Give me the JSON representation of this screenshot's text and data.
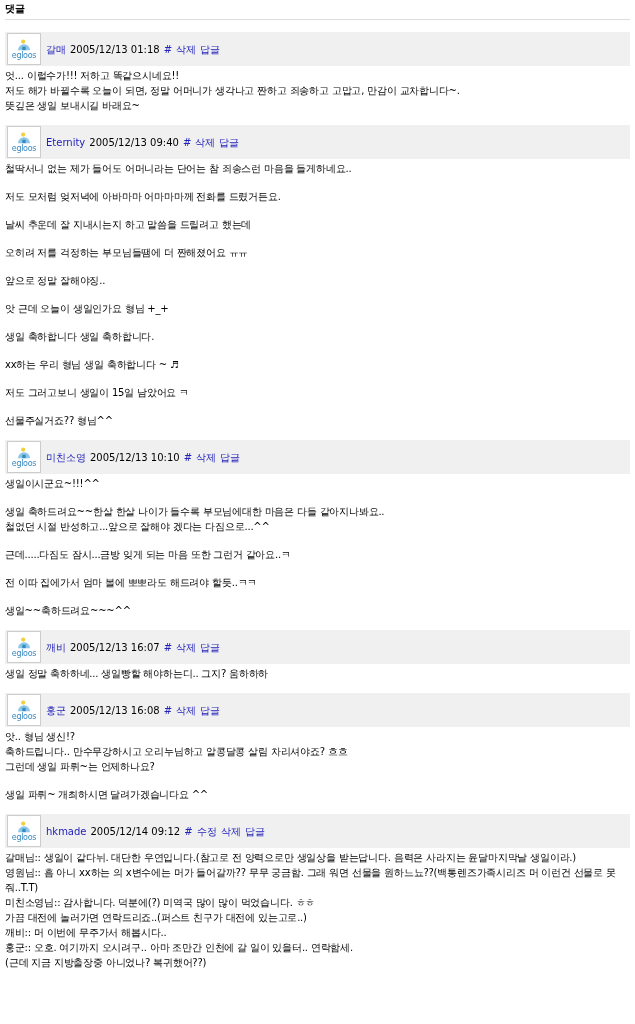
{
  "section_title": "댓글",
  "comments": [
    {
      "author": "갈매",
      "avatar_label": "egloos",
      "date": "2005/12/13 01:18",
      "actions": [
        "#",
        "삭제",
        "답글"
      ],
      "blocks": [
        [
          "엇... 이럴수가!!! 저하고 똑같으시네요!!",
          "저도 해가 바뀔수록 오늘이 되면, 정말 어머니가 생각나고 짠하고 죄송하고 고맙고, 만감이 교차합니다~.",
          "뜻깊은 생일 보내시길 바래요~"
        ]
      ]
    },
    {
      "author": "Eternity",
      "avatar_label": "egloos",
      "date": "2005/12/13 09:40",
      "actions": [
        "#",
        "삭제",
        "답글"
      ],
      "blocks": [
        [
          "철딱서니 없는 제가 들어도 어머니라는 단어는 참 죄송스런 마음을 들게하네요.."
        ],
        [
          "저도 모처럼 엊저녁에 아바마마 어마마마께 전화를 드렸거든요."
        ],
        [
          "날씨 추운데 잘 지내시는지 하고 말씀을 드릴려고 했는데"
        ],
        [
          "오히려 저를 걱정하는 부모님들땜에 더 짠해졌어요 ㅠㅠ"
        ],
        [
          "앞으로 정말 잘해야징.."
        ],
        [
          "앗 근데 오늘이 생일인가요 형님 +_+"
        ],
        [
          "생일 축하합니다 생일 축하합니다."
        ],
        [
          "xx하는 우리 형님 생일 축하합니다 ~ ♬"
        ],
        [
          "저도 그러고보니 생일이 15일 남았어요 ㅋ"
        ],
        [
          "선물주실거죠?? 형님^^"
        ]
      ]
    },
    {
      "author": "미친소영",
      "avatar_label": "egloos",
      "date": "2005/12/13 10:10",
      "actions": [
        "#",
        "삭제",
        "답글"
      ],
      "blocks": [
        [
          "생일이시군요~!!!^^"
        ],
        [
          "생일 축하드려요~~한살 한살 나이가 들수록 부모님에대한 마음은 다들 같아지나봐요..",
          "철없던 시절 반성하고...앞으로 잘해야 겠다는 다짐으로...^^"
        ],
        [
          "근데.....다짐도 잠시...금방 잊게 되는 마음 또한 그런거 같아요..ㅋ"
        ],
        [
          "전 이따 집에가서 엄마 볼에 뽀뽀라도 해드려야 할듯..ㅋㅋ"
        ],
        [
          "생일~~축하드려요~~~^^"
        ]
      ]
    },
    {
      "author": "깨비",
      "avatar_label": "egloos",
      "date": "2005/12/13 16:07",
      "actions": [
        "#",
        "삭제",
        "답글"
      ],
      "blocks": [
        [
          "생일 정말 축하하네... 생일빵할 해야하는디.. 그지? 움하하하"
        ]
      ]
    },
    {
      "author": "홍군",
      "avatar_label": "egloos",
      "date": "2005/12/13 16:08",
      "actions": [
        "#",
        "삭제",
        "답글"
      ],
      "blocks": [
        [
          "앗.. 형님 생신!?",
          "축하드립니다.. 만수무강하시고 오리누님하고 알콩달콩 살림 차리셔야죠? 흐흐",
          "그런데 생일 파뤼~는 언제하나요?"
        ],
        [
          "생일 파뤼~ 개최하시면 달려가겠습니다요 ^^"
        ]
      ]
    },
    {
      "author": "hkmade",
      "avatar_label": "egloos",
      "date": "2005/12/14 09:12",
      "actions": [
        "#",
        "수정",
        "삭제",
        "답글"
      ],
      "blocks": [
        [
          "갈매님:: 생일이 같다뉘. 대단한 우연입니다.(참고로 전 양력으로만 생일상을 받는답니다. 음력은 사라지는 윤달마지막날 생일이라.)",
          "영원님:: 흠 아니 xx하는 의 x변수에는 머가 들어갈까?? 무무 궁금함. 그래 워면 선물을 원하느뇨??(백통렌즈가족시리즈 머 이런건 선물로 못줘..T.T)",
          "미친소영님:: 감사합니다. 덕분에(?) 미역국 많이 많이 먹었습니다. ㅎㅎ",
          "가끔 대전에 놀러가면 연락드리죠..(퍼스트 친구가 대전에 있는고로..)",
          "깨비:: 머 이번에 무주가서 해봅시다..",
          "홍군:: 오호. 여기까지 오시려구.. 아마 조만간 인천에 갈 일이 있을터.. 연락함세.",
          "(근데 지금 지방출장중 아니었나? 복귀했어??)"
        ]
      ]
    }
  ]
}
